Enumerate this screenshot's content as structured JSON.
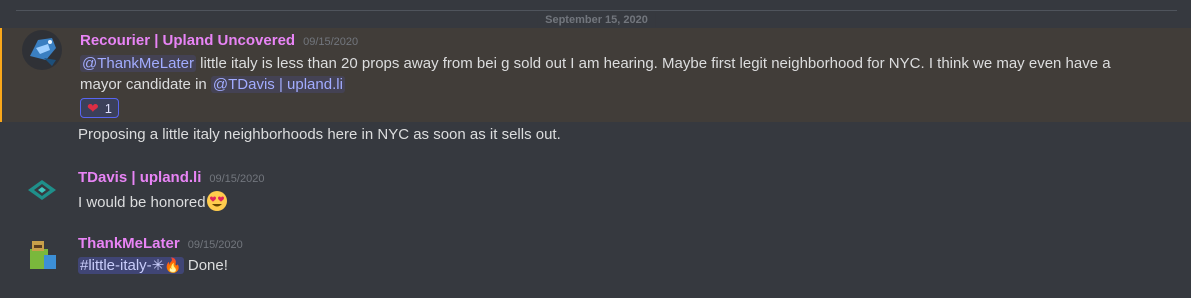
{
  "divider": {
    "date": "September 15, 2020"
  },
  "messages": [
    {
      "username": "Recourier | Upland Uncovered",
      "timestamp": "09/15/2020",
      "mention_start": "@ThankMeLater",
      "text_a": " little italy is less than 20 props away from bei g sold out I am hearing. Maybe first legit neighborhood for NYC.  I think we may even have a mayor candidate in ",
      "mention_end": "@TDavis | upland.li",
      "reaction": {
        "emoji": "heart",
        "count": "1"
      },
      "followup": "Proposing a little italy neighborhoods here in NYC as soon as it sells out."
    },
    {
      "username": "TDavis | upland.li",
      "timestamp": "09/15/2020",
      "text": "I would be honored",
      "emoji": "heart-eyes-emoji"
    },
    {
      "username": "ThankMeLater",
      "timestamp": "09/15/2020",
      "channel": "#little-italy-✳",
      "text": " Done!"
    }
  ],
  "colors": {
    "background": "#36393f",
    "username": "#e884f5",
    "highlight_border": "#faa81a",
    "mention": "#a2acff"
  }
}
